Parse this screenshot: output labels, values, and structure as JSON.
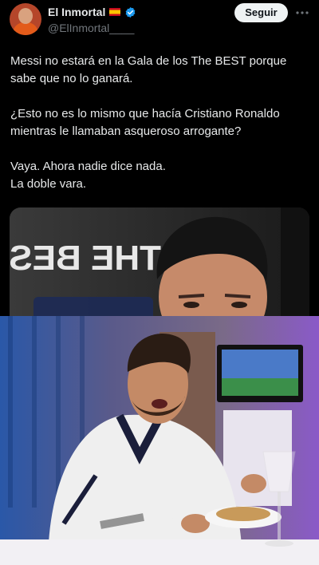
{
  "author": {
    "display_name": "El Inmortal",
    "handle": "@ElInmortal____",
    "flag_icon": "spain-flag-icon",
    "verified_icon": "verified-badge-icon",
    "verified_color": "#1d9bf0"
  },
  "follow_button": {
    "label": "Seguir"
  },
  "more_icon": "more-options-icon",
  "tweet": {
    "paragraph_1": "Messi no estará en la Gala de los The BEST porque sabe que no lo ganará.",
    "paragraph_2": "¿Esto no es lo mismo que hacía Cristiano Ronaldo mientras le llamaban asqueroso arrogante?",
    "paragraph_3_line_1": "Vaya. Ahora nadie dice nada.",
    "paragraph_3_line_2": "La doble vara."
  },
  "media": {
    "top_image_text": "THE BEST"
  },
  "colors": {
    "background": "#000000",
    "text_primary": "#e7e9ea",
    "text_secondary": "#71767b",
    "button_bg": "#eff3f4"
  }
}
